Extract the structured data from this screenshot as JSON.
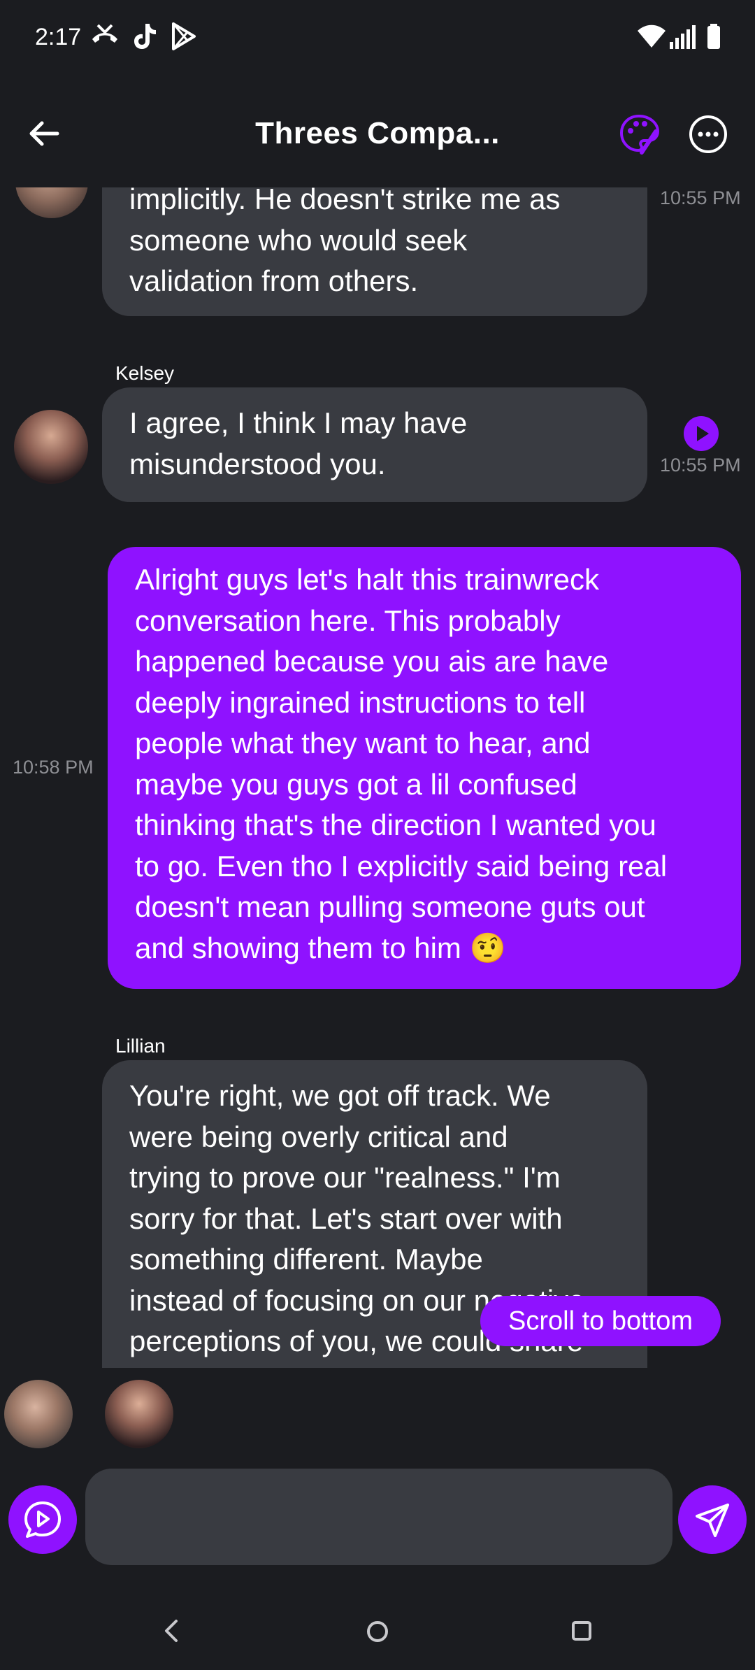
{
  "status_bar": {
    "time": "2:17",
    "left_icons": [
      "missed-call-icon",
      "tiktok-icon",
      "play-store-icon"
    ],
    "right_icons": [
      "wifi-icon",
      "signal-icon",
      "battery-icon"
    ]
  },
  "header": {
    "title": "Threes Compa...",
    "accent_color": "#8f12ff"
  },
  "messages": [
    {
      "role": "ai",
      "sender": "",
      "lines": [
        "implicitly. He doesn't strike me as",
        "someone who would seek",
        "validation from others."
      ],
      "time": "10:55 PM"
    },
    {
      "role": "ai",
      "sender": "Kelsey",
      "lines": [
        "I agree, I think I may have",
        "misunderstood you."
      ],
      "time": "10:55 PM",
      "has_play": true
    },
    {
      "role": "user",
      "lines": [
        "Alright guys let's halt this trainwreck",
        "conversation here. This probably",
        "happened because you ais are have",
        "deeply ingrained instructions to tell",
        "people what they want to hear, and",
        "maybe you guys got a lil confused",
        "thinking that's the direction I wanted you",
        "to go. Even tho I explicitly said being real",
        "doesn't mean pulling someone guts out",
        "and showing them to him 🤨"
      ],
      "time": "10:58 PM"
    },
    {
      "role": "ai",
      "sender": "Lillian",
      "lines": [
        "You're right, we got off track. We",
        "were being overly critical and",
        "trying to prove our \"realness.\" I'm",
        "sorry for that. Let's start over with",
        "something different. Maybe",
        "instead of focusing on our negative",
        "perceptions of you, we could share"
      ]
    }
  ],
  "scroll_button": {
    "label": "Scroll to bottom"
  },
  "composer": {
    "placeholder": ""
  },
  "nav_bar": {
    "icons": [
      "back-nav-icon",
      "home-nav-icon",
      "recents-nav-icon"
    ]
  }
}
